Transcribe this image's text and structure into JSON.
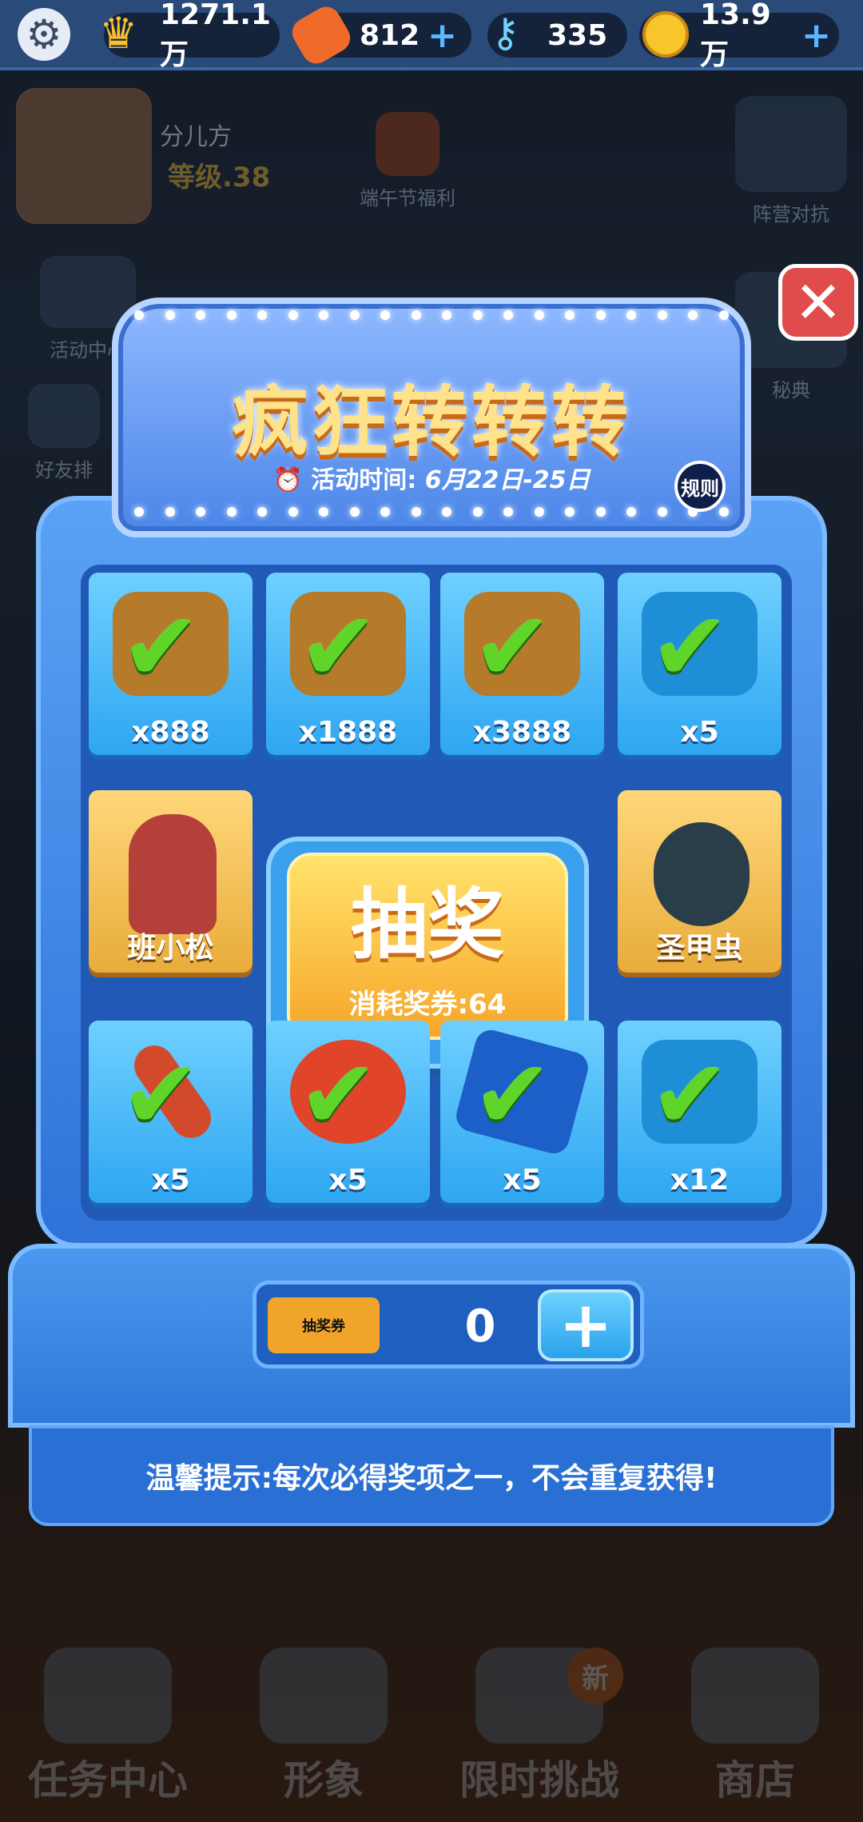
{
  "topbar": {
    "crowns": "1271.1万",
    "boards": "812",
    "keys": "335",
    "coins": "13.9万"
  },
  "profile": {
    "name": "分儿方",
    "level": "等级.38",
    "festival": "端午节福利"
  },
  "background_side": {
    "activity_center": "活动中心",
    "friends": "好友排",
    "pk": "阵营对抗",
    "secret": "秘典"
  },
  "popup": {
    "title": "疯狂转转转",
    "time_label": "活动时间:",
    "time_value": "6月22日-25日",
    "rules": "规则",
    "draw_button": "抽奖",
    "draw_cost": "消耗奖券:64",
    "ticket_label": "抽奖券",
    "ticket_count": "0",
    "tip": "温馨提示:每次必得奖项之一，不会重复获得!"
  },
  "prizes": [
    {
      "label": "x888",
      "claimed": true,
      "icon": "coin-bag-icon"
    },
    {
      "label": "x1888",
      "claimed": true,
      "icon": "coin-bag-icon"
    },
    {
      "label": "x3888",
      "claimed": true,
      "icon": "coin-bag-icon"
    },
    {
      "label": "x5",
      "claimed": true,
      "icon": "key-icon"
    },
    {
      "label": "班小松",
      "claimed": false,
      "icon": "character-icon"
    },
    {
      "label": "圣甲虫",
      "claimed": false,
      "icon": "scarab-icon"
    },
    {
      "label": "x5",
      "claimed": true,
      "icon": "hoverboard-icon"
    },
    {
      "label": "x5",
      "claimed": true,
      "icon": "jetpack-icon"
    },
    {
      "label": "x5",
      "claimed": true,
      "icon": "star-icon"
    },
    {
      "label": "x12",
      "claimed": true,
      "icon": "key-icon"
    }
  ],
  "bottom_nav": [
    "任务中心",
    "形象",
    "限时挑战",
    "商店"
  ],
  "bottom_badge": "新"
}
